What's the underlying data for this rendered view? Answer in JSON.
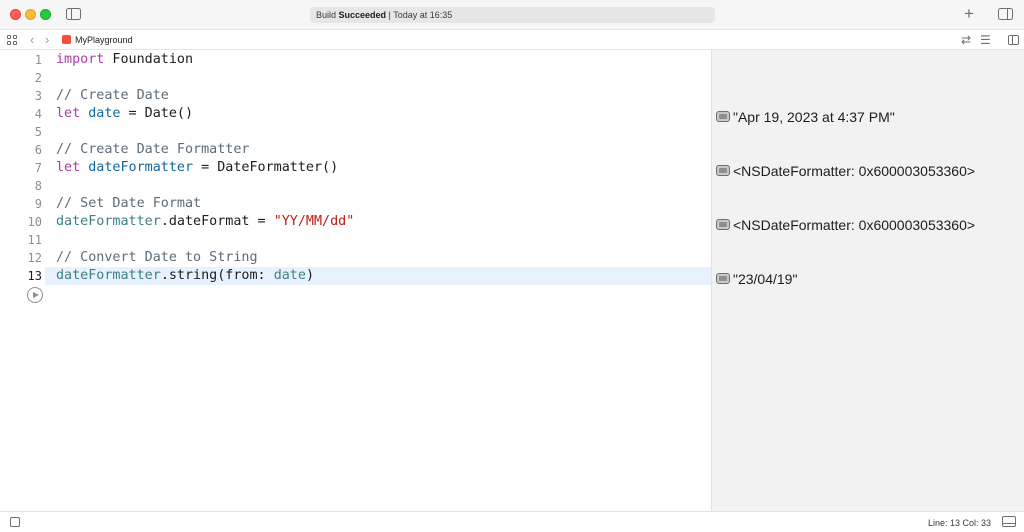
{
  "window": {
    "status_prefix": "Build ",
    "status_bold": "Succeeded",
    "status_suffix": " | Today at 16:35"
  },
  "jumpbar": {
    "file_name": "MyPlayground"
  },
  "editor": {
    "current_line": 13,
    "lines": [
      {
        "num": "1",
        "tokens": [
          {
            "t": "import",
            "c": "kw"
          },
          {
            "t": " Foundation",
            "c": ""
          }
        ]
      },
      {
        "num": "2",
        "tokens": []
      },
      {
        "num": "3",
        "tokens": [
          {
            "t": "// Create Date",
            "c": "cm"
          }
        ]
      },
      {
        "num": "4",
        "tokens": [
          {
            "t": "let",
            "c": "kw"
          },
          {
            "t": " ",
            "c": ""
          },
          {
            "t": "date",
            "c": "pl"
          },
          {
            "t": " = Date()",
            "c": ""
          }
        ]
      },
      {
        "num": "5",
        "tokens": []
      },
      {
        "num": "6",
        "tokens": [
          {
            "t": "// Create Date Formatter",
            "c": "cm"
          }
        ]
      },
      {
        "num": "7",
        "tokens": [
          {
            "t": "let",
            "c": "kw"
          },
          {
            "t": " ",
            "c": ""
          },
          {
            "t": "dateFormatter",
            "c": "pl"
          },
          {
            "t": " = DateFormatter()",
            "c": ""
          }
        ]
      },
      {
        "num": "8",
        "tokens": []
      },
      {
        "num": "9",
        "tokens": [
          {
            "t": "// Set Date Format",
            "c": "cm"
          }
        ]
      },
      {
        "num": "10",
        "tokens": [
          {
            "t": "dateFormatter",
            "c": "id"
          },
          {
            "t": ".dateFormat = ",
            "c": ""
          },
          {
            "t": "\"YY/MM/dd\"",
            "c": "str"
          }
        ]
      },
      {
        "num": "11",
        "tokens": []
      },
      {
        "num": "12",
        "tokens": [
          {
            "t": "// Convert Date to String",
            "c": "cm"
          }
        ]
      },
      {
        "num": "13",
        "tokens": [
          {
            "t": "dateFormatter",
            "c": "id"
          },
          {
            "t": ".string(from: ",
            "c": ""
          },
          {
            "t": "date",
            "c": "id"
          },
          {
            "t": ")",
            "c": ""
          }
        ]
      }
    ]
  },
  "results": [
    {
      "line": 4,
      "text": "\"Apr 19, 2023 at 4:37 PM\""
    },
    {
      "line": 7,
      "text": "<NSDateFormatter: 0x600003053360>"
    },
    {
      "line": 10,
      "text": "<NSDateFormatter: 0x600003053360>"
    },
    {
      "line": 13,
      "text": "\"23/04/19\""
    }
  ],
  "statusbar": {
    "position": "Line: 13  Col: 33"
  }
}
